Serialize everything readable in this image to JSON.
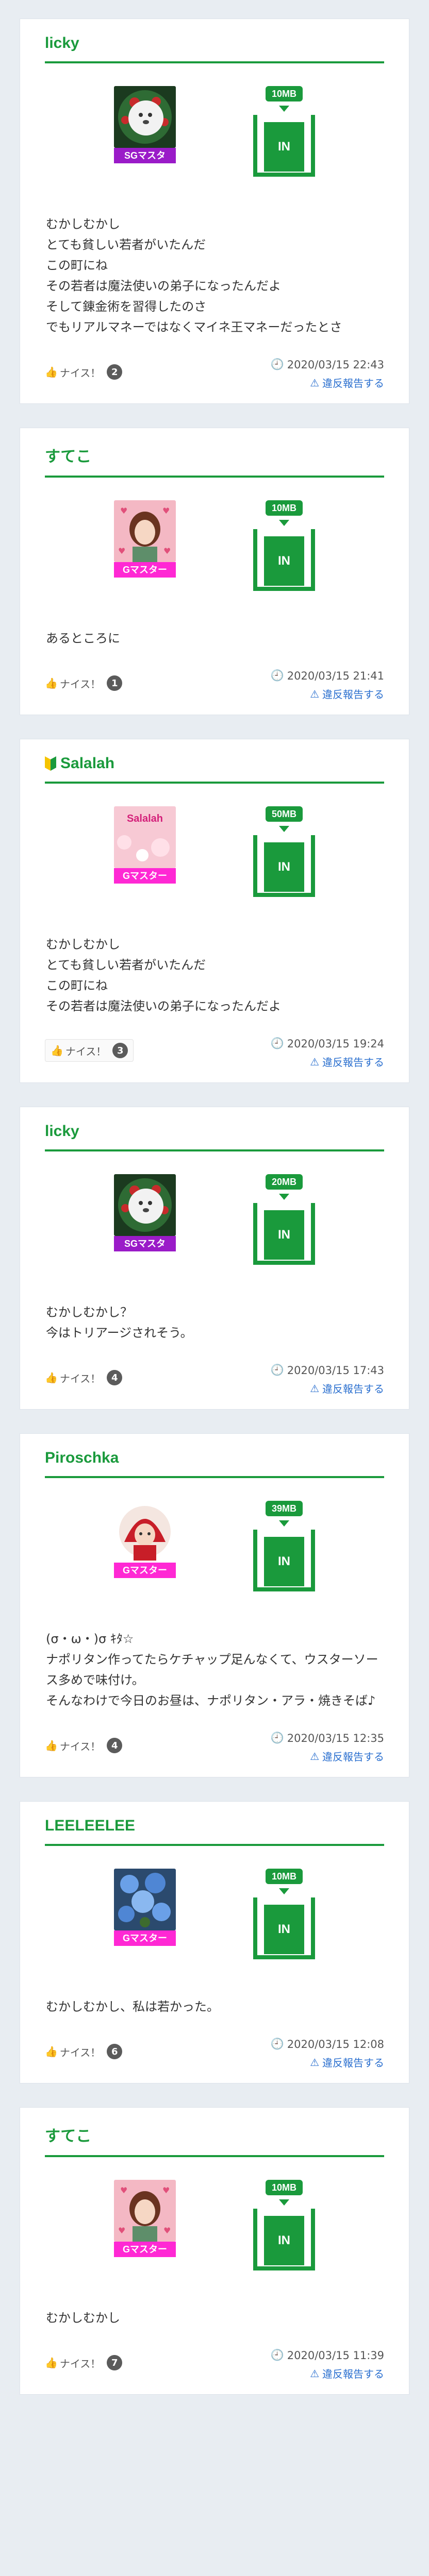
{
  "labels": {
    "nice": "ナイス！",
    "report": "違反報告する"
  },
  "posts": [
    {
      "user": "licky",
      "badge": "SGマスタ",
      "size": "10MB",
      "bin_label": "IN",
      "text": "むかしむかし\nとても貧しい若者がいたんだ\nこの町にね\nその若者は魔法使いの弟子になったんだよ\nそして錬金術を習得したのさ\nでもリアルマネーではなくマイネ王マネーだったとさ",
      "nice_count": "2",
      "date": "2020/03/15 22:43"
    },
    {
      "user": "すてこ",
      "badge": "Gマスター",
      "size": "10MB",
      "bin_label": "IN",
      "text": "あるところに",
      "nice_count": "1",
      "date": "2020/03/15 21:41"
    },
    {
      "user": "Salalah",
      "badge": "Gマスター",
      "size": "50MB",
      "bin_label": "IN",
      "avatar_text": "Salalah",
      "text": "むかしむかし\nとても貧しい若者がいたんだ\nこの町にね\nその若者は魔法使いの弟子になったんだよ",
      "nice_count": "3",
      "date": "2020/03/15 19:24"
    },
    {
      "user": "licky",
      "badge": "SGマスタ",
      "size": "20MB",
      "bin_label": "IN",
      "text": "むかしむかし？\n今はトリアージされそう。",
      "nice_count": "4",
      "date": "2020/03/15 17:43"
    },
    {
      "user": "Piroschka",
      "badge": "Gマスター",
      "size": "39MB",
      "bin_label": "IN",
      "text": "(σ・ω・)σ ｷﾀ☆\nナポリタン作ってたらケチャップ足んなくて、ウスターソース多めで味付け。\nそんなわけで今日のお昼は、ナポリタン・アラ・焼きそば♪",
      "nice_count": "4",
      "date": "2020/03/15 12:35"
    },
    {
      "user": "LEELEELEE",
      "badge": "Gマスター",
      "size": "10MB",
      "bin_label": "IN",
      "text": "むかしむかし、私は若かった。",
      "nice_count": "6",
      "date": "2020/03/15 12:08"
    },
    {
      "user": "すてこ",
      "badge": "Gマスター",
      "size": "10MB",
      "bin_label": "IN",
      "text": "むかしむかし",
      "nice_count": "7",
      "date": "2020/03/15 11:39"
    }
  ]
}
